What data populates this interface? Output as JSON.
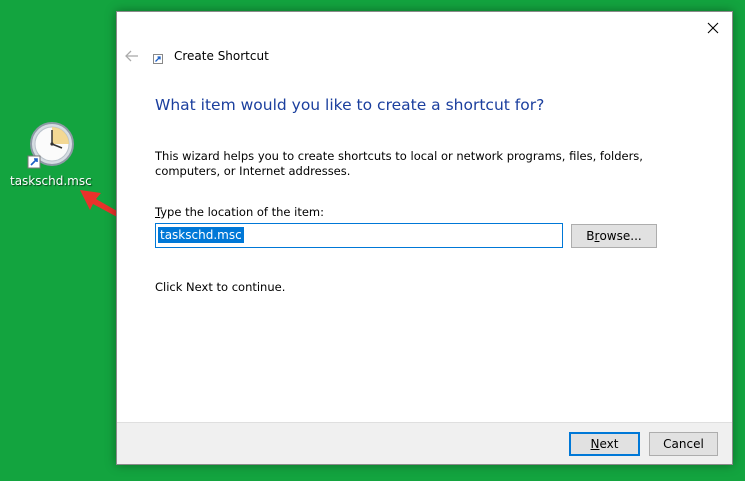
{
  "desktop": {
    "icon_label": "taskschd.msc",
    "icon": "clock-shortcut-icon"
  },
  "dialog": {
    "title": "Create Shortcut",
    "close_icon": "close-icon",
    "back_icon": "back-arrow-icon",
    "heading": "What item would you like to create a shortcut for?",
    "description": "This wizard helps you to create shortcuts to local or network programs, files, folders, computers, or Internet addresses.",
    "field_label_accel": "T",
    "field_label_rest": "ype the location of the item:",
    "location_value": "taskschd.msc",
    "browse_accel": "r",
    "browse_pre": "B",
    "browse_post": "owse...",
    "continue_text": "Click Next to continue.",
    "next_accel": "N",
    "next_rest": "ext",
    "cancel_label": "Cancel"
  },
  "colors": {
    "desktop_bg": "#13a43f",
    "heading": "#1b3f9e",
    "accent": "#0078d7",
    "annotation_arrow": "#e8322b"
  }
}
